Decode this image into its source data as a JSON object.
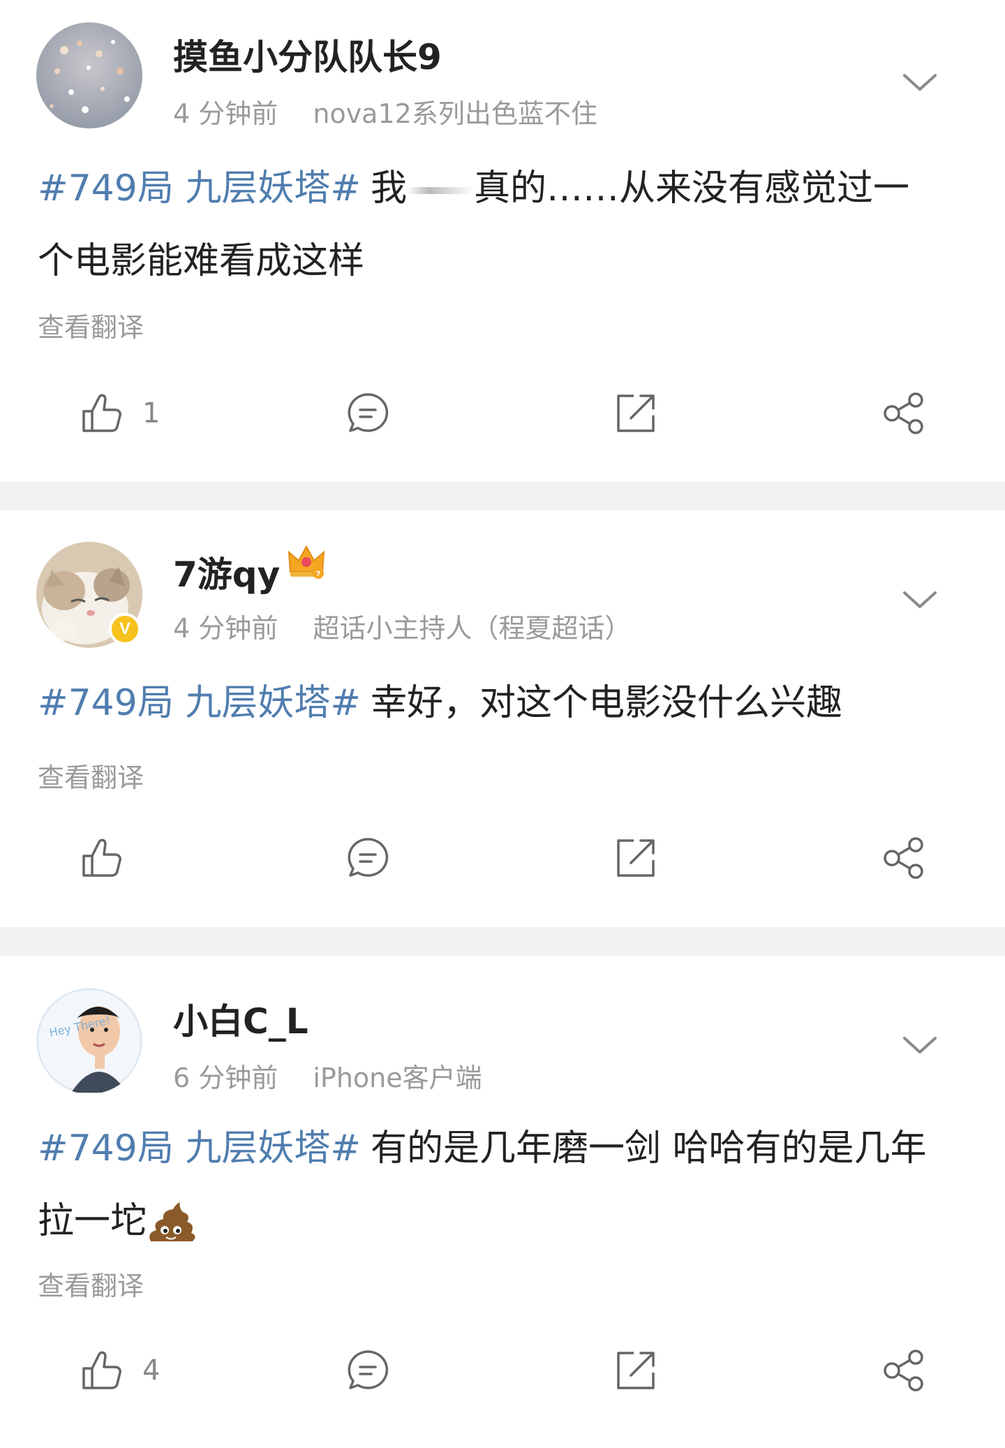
{
  "posts": [
    {
      "username": "摸鱼小分队队长9",
      "time": "4 分钟前",
      "source": "nova12系列出色蓝不住",
      "topic": "#749局 九层妖塔#",
      "text_before": "我",
      "text_after": "真的……从来没有感觉过一个电影能难看成这样",
      "translate": "查看翻译",
      "likes": "1"
    },
    {
      "username": "7游qy",
      "time": "4 分钟前",
      "source": "超话小主持人（程夏超话）",
      "topic": "#749局 九层妖塔#",
      "text": "幸好，对这个电影没什么兴趣",
      "translate": "查看翻译",
      "likes": ""
    },
    {
      "username": "小白C_L",
      "time": "6 分钟前",
      "source": "iPhone客户端",
      "topic": "#749局 九层妖塔#",
      "text": "有的是几年磨一剑 哈哈有的是几年拉一坨",
      "translate": "查看翻译",
      "likes": "4",
      "avatar_text": "Hey There!"
    }
  ],
  "colors": {
    "topic": "#507daf",
    "meta": "#9a9a9a",
    "icon": "#666666",
    "divider": "#f2f2f2",
    "verified_badge": "#f6c21c"
  },
  "icons": [
    "chevron-down-icon",
    "like-icon",
    "comment-icon",
    "repost-icon",
    "share-icon",
    "crown-icon",
    "poop-emoji"
  ]
}
